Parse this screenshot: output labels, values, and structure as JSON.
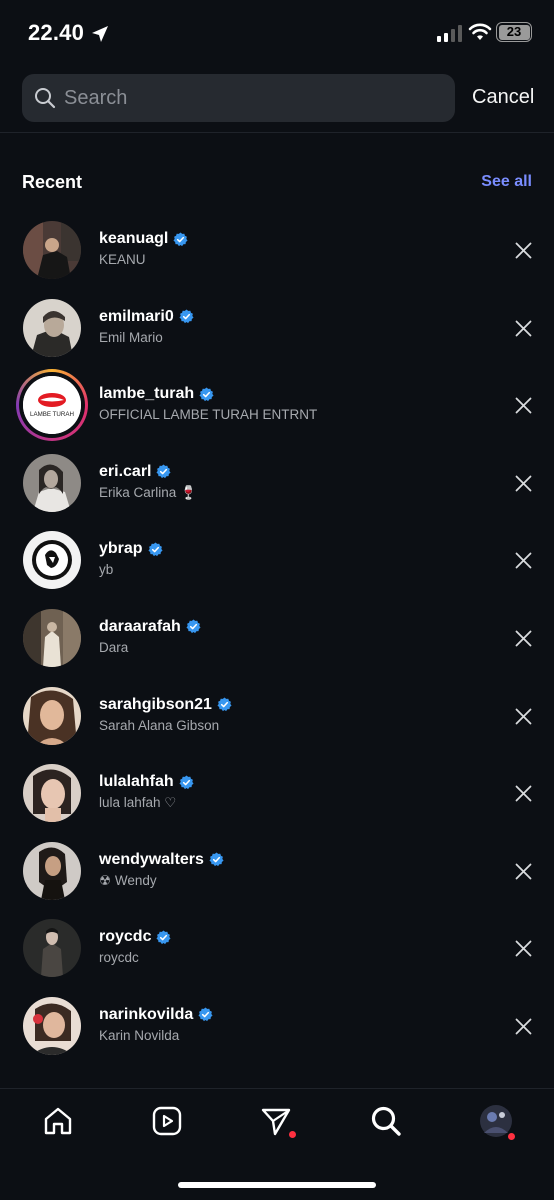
{
  "status_bar": {
    "time": "22.40",
    "battery": "23"
  },
  "search": {
    "placeholder": "Search",
    "value": "",
    "cancel_label": "Cancel"
  },
  "recent": {
    "title": "Recent",
    "see_all_label": "See all",
    "items": [
      {
        "username": "keanuagl",
        "fullname": "KEANU",
        "verified": true
      },
      {
        "username": "emilmari0",
        "fullname": "Emil Mario",
        "verified": true
      },
      {
        "username": "lambe_turah",
        "fullname": "OFFICIAL LAMBE TURAH ENTRNT",
        "verified": true,
        "avatar_text": "LAMBE TURAH"
      },
      {
        "username": "eri.carl",
        "fullname": "Erika Carlina 🍷",
        "verified": true
      },
      {
        "username": "ybrap",
        "fullname": "yb",
        "verified": true
      },
      {
        "username": "daraarafah",
        "fullname": "Dara",
        "verified": true
      },
      {
        "username": "sarahgibson21",
        "fullname": "Sarah Alana Gibson",
        "verified": true
      },
      {
        "username": "lulalahfah",
        "fullname": "lula lahfah ♡",
        "verified": true
      },
      {
        "username": "wendywalters",
        "fullname": "☢ Wendy",
        "verified": true
      },
      {
        "username": "roycdc",
        "fullname": "roycdc",
        "verified": true
      },
      {
        "username": "narinkovilda",
        "fullname": "Karin Novilda",
        "verified": true
      }
    ]
  },
  "tab_bar": {
    "tabs": [
      {
        "name": "home",
        "icon": "home-icon"
      },
      {
        "name": "reels",
        "icon": "reels-icon"
      },
      {
        "name": "direct",
        "icon": "send-icon",
        "badge": true
      },
      {
        "name": "search",
        "icon": "search-icon",
        "active": true
      },
      {
        "name": "profile",
        "icon": "avatar",
        "badge": true
      }
    ]
  },
  "colors": {
    "background": "#0c0f14",
    "accent_link": "#7a8dff",
    "verified": "#3897f0",
    "badge": "#ff3040"
  }
}
